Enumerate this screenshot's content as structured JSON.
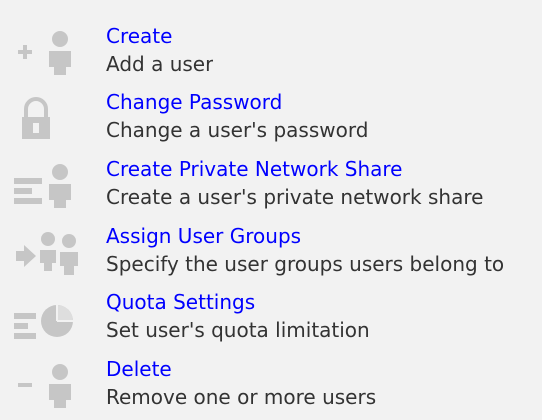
{
  "colors": {
    "background": "#f2f2f2",
    "link": "#0000ff",
    "description": "#333333",
    "icon": "#c6c6c6"
  },
  "actions": [
    {
      "title": "Create",
      "description": "Add a user",
      "icon": "add-user-icon"
    },
    {
      "title": "Change Password",
      "description": "Change a user's password",
      "icon": "padlock-icon"
    },
    {
      "title": "Create Private Network Share",
      "description": "Create a user's private network share",
      "icon": "network-share-icon"
    },
    {
      "title": "Assign User Groups",
      "description": "Specify the user groups users belong to",
      "icon": "user-groups-icon"
    },
    {
      "title": "Quota Settings",
      "description": "Set user's quota limitation",
      "icon": "quota-pie-icon"
    },
    {
      "title": "Delete",
      "description": "Remove one or more users",
      "icon": "remove-user-icon"
    }
  ]
}
